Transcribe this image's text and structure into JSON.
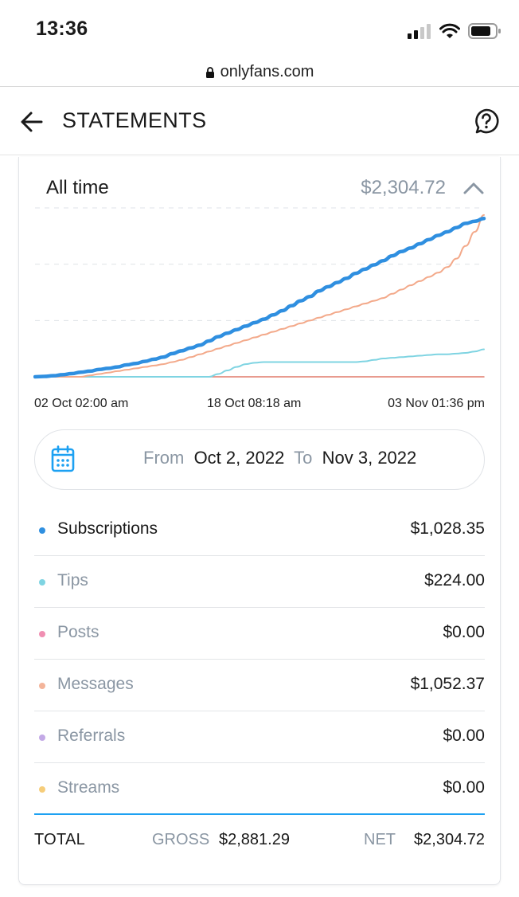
{
  "status_bar": {
    "time": "13:36"
  },
  "browser": {
    "url": "onlyfans.com"
  },
  "header": {
    "title": "STATEMENTS"
  },
  "summary": {
    "period": "All time",
    "total": "$2,304.72"
  },
  "chart_data": {
    "type": "line",
    "x": [
      "02 Oct 02:00 am",
      "18 Oct 08:18 am",
      "03 Nov 01:36 pm"
    ],
    "xlabel": "",
    "ylabel": "",
    "grid": true,
    "series": [
      {
        "color": "#2f8fe0",
        "values": [
          0,
          0.5,
          1.5,
          3,
          4.5,
          6.5,
          8,
          10.5,
          12,
          14,
          17,
          19,
          22,
          25,
          28,
          33,
          37,
          41,
          45,
          51,
          57,
          62,
          67,
          72,
          77,
          82,
          88,
          94,
          101,
          108,
          114,
          122,
          128,
          134,
          140,
          147,
          153,
          159,
          165,
          172,
          178,
          183,
          189,
          195,
          201,
          206,
          212,
          218,
          221,
          225
        ]
      },
      {
        "color": "#f3a98a",
        "values": [
          0,
          0,
          0,
          0,
          0,
          0,
          2,
          4,
          6,
          8,
          10,
          12,
          14,
          16,
          18,
          21,
          24,
          28,
          32,
          36,
          40,
          44,
          48,
          52,
          56,
          60,
          64,
          68,
          72,
          76,
          80,
          84,
          88,
          92,
          96,
          100,
          104,
          108,
          112,
          118,
          124,
          130,
          136,
          142,
          148,
          156,
          168,
          186,
          206,
          230
        ]
      },
      {
        "color": "#7fd4e2",
        "values": [
          0,
          0,
          0,
          0,
          0,
          0,
          0,
          0,
          0,
          0,
          0,
          0,
          0,
          0,
          0,
          0,
          0,
          0,
          0,
          0,
          4,
          9,
          14,
          18,
          20,
          21,
          21,
          21,
          21,
          21,
          21,
          21,
          21,
          21,
          21,
          21,
          22,
          24,
          26,
          27,
          28,
          29,
          30,
          31,
          32,
          32,
          33,
          34,
          36,
          39
        ]
      },
      {
        "color": "#e07a6a",
        "values": [
          0,
          0,
          0,
          0,
          0,
          0,
          0,
          0,
          0,
          0,
          0,
          0,
          0,
          0,
          0,
          0,
          0,
          0,
          0,
          0,
          0,
          0,
          0,
          0,
          0,
          0,
          0,
          0,
          0,
          0,
          0,
          0,
          0,
          0,
          0,
          0,
          0,
          0,
          0,
          0,
          0,
          0,
          0,
          0,
          0,
          0,
          0,
          0,
          0,
          0
        ]
      }
    ],
    "ylim": [
      0,
      240
    ]
  },
  "date_range": {
    "from_label": "From",
    "from": "Oct 2, 2022",
    "to_label": "To",
    "to": "Nov 3, 2022"
  },
  "categories": [
    {
      "label": "Subscriptions",
      "amount": "$1,028.35",
      "color": "#2f8fe0",
      "active": true
    },
    {
      "label": "Tips",
      "amount": "$224.00",
      "color": "#7fd4e2",
      "active": false
    },
    {
      "label": "Posts",
      "amount": "$0.00",
      "color": "#f08fb2",
      "active": false
    },
    {
      "label": "Messages",
      "amount": "$1,052.37",
      "color": "#f3b49a",
      "active": false
    },
    {
      "label": "Referrals",
      "amount": "$0.00",
      "color": "#c3a9e6",
      "active": false
    },
    {
      "label": "Streams",
      "amount": "$0.00",
      "color": "#f6cd7a",
      "active": false
    }
  ],
  "totals": {
    "label": "TOTAL",
    "gross_label": "GROSS",
    "gross": "$2,881.29",
    "net_label": "NET",
    "net": "$2,304.72"
  },
  "icons": {
    "back": "arrow-left-icon",
    "help": "question-circle-icon",
    "collapse": "chevron-up-icon",
    "calendar": "calendar-icon",
    "lock": "lock-icon"
  }
}
